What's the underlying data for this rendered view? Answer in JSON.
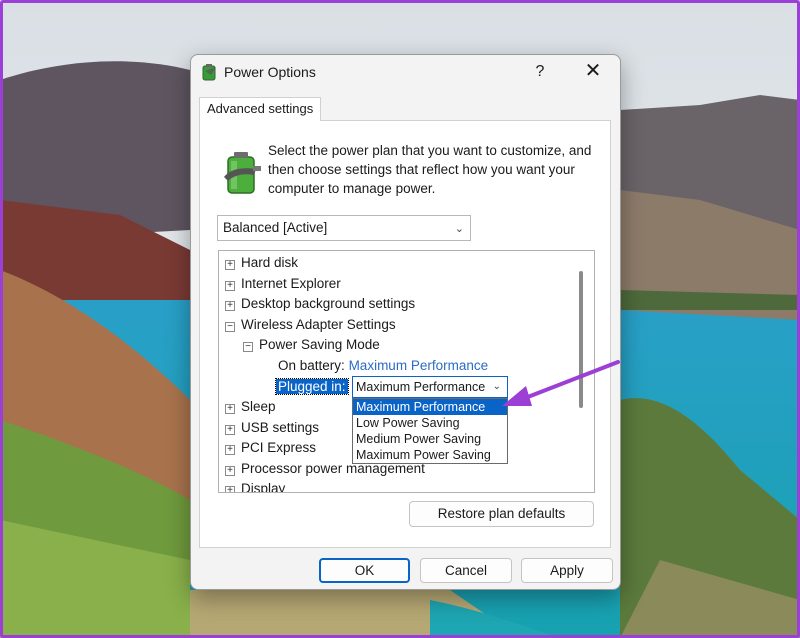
{
  "window": {
    "title": "Power Options",
    "help_label": "?",
    "close_label": "✕"
  },
  "tab": {
    "label": "Advanced settings"
  },
  "intro_text": "Select the power plan that you want to customize, and then choose settings that reflect how you want your computer to manage power.",
  "plan_select": {
    "value": "Balanced [Active]"
  },
  "tree": {
    "items": [
      {
        "label": "Hard disk",
        "expander": "+"
      },
      {
        "label": "Internet Explorer",
        "expander": "+"
      },
      {
        "label": "Desktop background settings",
        "expander": "+"
      },
      {
        "label": "Wireless Adapter Settings",
        "expander": "−"
      },
      {
        "label": "Power Saving Mode",
        "expander": "−"
      },
      {
        "label": "Sleep",
        "expander": "+"
      },
      {
        "label": "USB settings",
        "expander": "+"
      },
      {
        "label": "PCI Express",
        "expander": "+"
      },
      {
        "label": "Processor power management",
        "expander": "+"
      },
      {
        "label": "Display",
        "expander": "+"
      }
    ],
    "on_battery": {
      "label": "On battery:",
      "value": "Maximum Performance"
    },
    "plugged_in": {
      "label": "Plugged in:",
      "value": "Maximum Performance"
    }
  },
  "dropdown": {
    "options": [
      "Maximum Performance",
      "Low Power Saving",
      "Medium Power Saving",
      "Maximum Power Saving"
    ],
    "selected_index": 0
  },
  "buttons": {
    "restore": "Restore plan defaults",
    "ok": "OK",
    "cancel": "Cancel",
    "apply": "Apply"
  },
  "colors": {
    "accent": "#0a64c8",
    "link": "#2b6cc4",
    "annotation_arrow": "#9b3fd6"
  }
}
